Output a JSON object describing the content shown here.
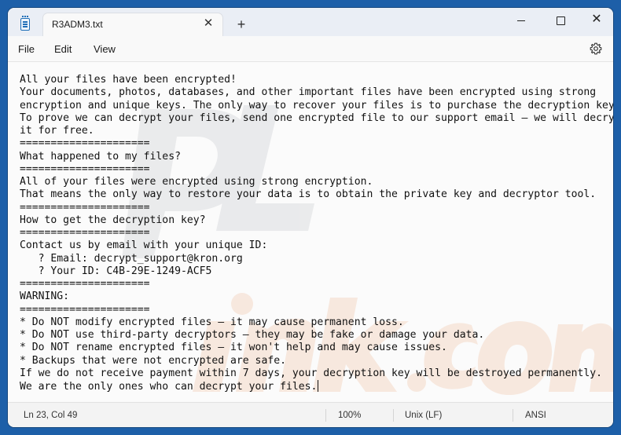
{
  "tab": {
    "title": "R3ADM3.txt",
    "close_symbol": "✕",
    "new_tab_symbol": "+"
  },
  "window_controls": {
    "close_symbol": "✕"
  },
  "menu": {
    "file": "File",
    "edit": "Edit",
    "view": "View"
  },
  "document": {
    "lines": [
      "All your files have been encrypted!",
      "Your documents, photos, databases, and other important files have been encrypted using strong",
      "encryption and unique keys. The only way to recover your files is to purchase the decryption key.",
      "To prove we can decrypt your files, send one encrypted file to our support email — we will decrypt",
      "it for free.",
      "=====================",
      "What happened to my files?",
      "=====================",
      "All of your files were encrypted using strong encryption.",
      "That means the only way to restore your data is to obtain the private key and decryptor tool.",
      "=====================",
      "How to get the decryption key?",
      "=====================",
      "Contact us by email with your unique ID:",
      "   ? Email: decrypt_support@kron.org",
      "   ? Your ID: C4B-29E-1249-ACF5",
      "=====================",
      "WARNING:",
      "=====================",
      "* Do NOT modify encrypted files — it may cause permanent loss.",
      "* Do NOT use third-party decryptors — they may be fake or damage your data.",
      "* Do NOT rename encrypted files — it won't help and may cause issues.",
      "* Backups that were not encrypted are safe.",
      "If we do not receive payment within 7 days, your decryption key will be destroyed permanently.",
      "We are the only ones who can decrypt your files."
    ]
  },
  "status": {
    "position": "Ln 23, Col 49",
    "zoom": "100%",
    "line_ending": "Unix (LF)",
    "encoding": "ANSI"
  },
  "colors": {
    "desktop": "#1d5fa8",
    "titlebar": "#eaeef5",
    "accent": "#1f6fb8",
    "watermark_dark": "#d5d7da",
    "watermark_orange": "#f4d9c8"
  },
  "icons": {
    "app": "notepad-icon",
    "settings": "gear-icon",
    "minimize": "minimize-icon",
    "maximize": "maximize-icon",
    "close": "close-icon"
  }
}
